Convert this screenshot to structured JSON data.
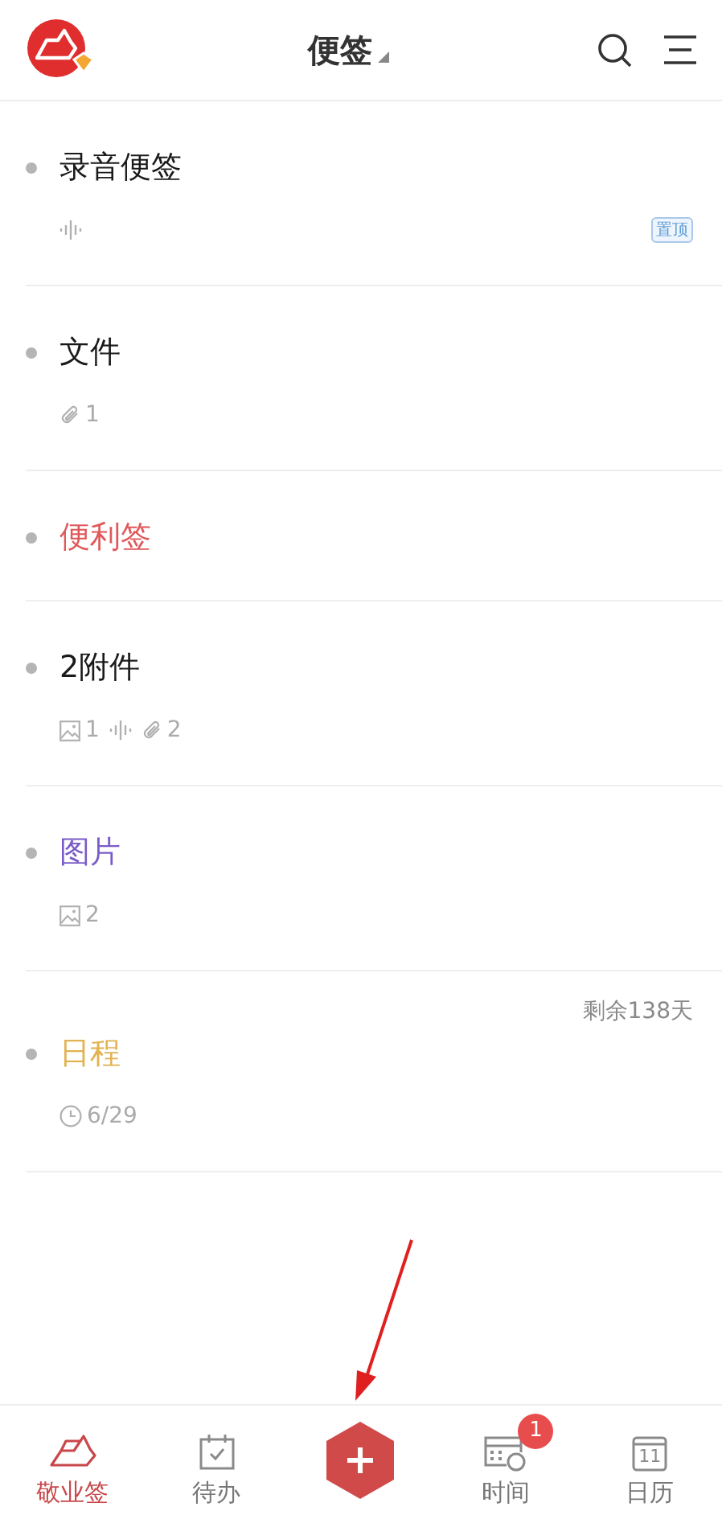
{
  "header": {
    "title": "便签"
  },
  "notes": [
    {
      "title": "录音便签",
      "color": "#1a1a1a",
      "meta": [
        {
          "kind": "audio"
        }
      ],
      "pinned_label": "置顶"
    },
    {
      "title": "文件",
      "color": "#1a1a1a",
      "meta": [
        {
          "kind": "attach",
          "count": "1"
        }
      ]
    },
    {
      "title": "便利签",
      "color": "#e0585a"
    },
    {
      "title": "2附件",
      "color": "#1a1a1a",
      "meta": [
        {
          "kind": "image",
          "count": "1"
        },
        {
          "kind": "audio"
        },
        {
          "kind": "attach",
          "count": "2"
        }
      ]
    },
    {
      "title": "图片",
      "color": "#7a5cc8",
      "meta": [
        {
          "kind": "image",
          "count": "2"
        }
      ]
    },
    {
      "title": "日程",
      "color": "#e2b252",
      "remaining": "剩余138天",
      "meta": [
        {
          "kind": "clock",
          "count": "6/29"
        }
      ]
    }
  ],
  "tabbar": [
    {
      "kind": "notes",
      "label": "敬业签",
      "selected": true
    },
    {
      "kind": "todo",
      "label": "待办",
      "selected": false
    },
    {
      "kind": "add"
    },
    {
      "kind": "time",
      "label": "时间",
      "selected": false,
      "badge": "1"
    },
    {
      "kind": "calendar",
      "label": "日历",
      "selected": false,
      "day": "11"
    }
  ]
}
